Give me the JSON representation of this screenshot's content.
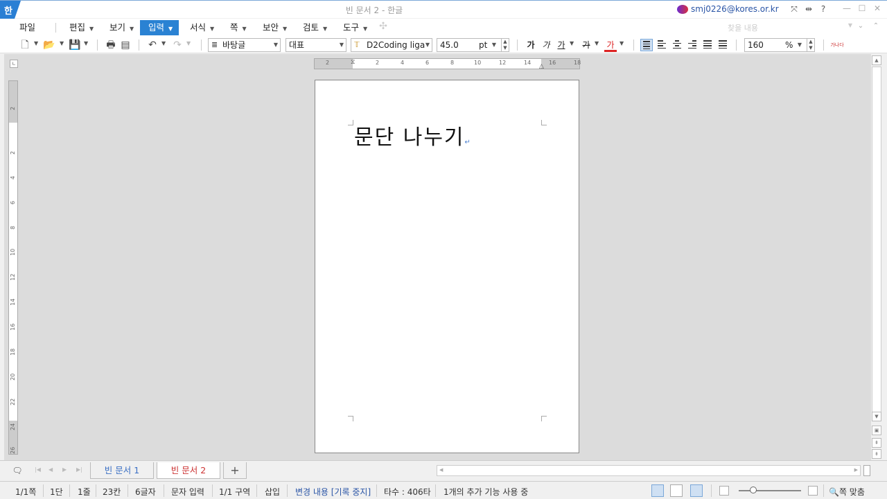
{
  "titlebar": {
    "logo": "한",
    "title": "빈 문서 2 - 한글",
    "account": "smj0226@kores.or.kr",
    "help": "?"
  },
  "menu": {
    "items": [
      {
        "label": "파일"
      },
      {
        "label": "편집"
      },
      {
        "label": "보기"
      },
      {
        "label": "입력"
      },
      {
        "label": "서식"
      },
      {
        "label": "쪽"
      },
      {
        "label": "보안"
      },
      {
        "label": "검토"
      },
      {
        "label": "도구"
      }
    ],
    "active": "입력",
    "search_placeholder": "찾을 내용"
  },
  "toolbar": {
    "style_combo": "바탕글",
    "lang_combo": "대표",
    "font_combo": "D2Coding liga",
    "size_value": "45.0",
    "size_unit": "pt",
    "bold": "가",
    "italic": "가",
    "underline": "가",
    "strike": "가",
    "color": "가",
    "zoom_value": "160",
    "zoom_unit": "%",
    "extra": "가나다"
  },
  "ruler": {
    "h_ticks": [
      "2",
      "2",
      "4",
      "6",
      "8",
      "10",
      "12",
      "14",
      "16",
      "18"
    ],
    "v_ticks": [
      "2",
      "2",
      "4",
      "6",
      "8",
      "10",
      "12",
      "14",
      "16",
      "18",
      "20",
      "22",
      "24",
      "26"
    ]
  },
  "document": {
    "text": "문단 나누기",
    "para_mark": "↵"
  },
  "tabs": [
    {
      "label": "빈 문서 1",
      "active": false
    },
    {
      "label": "빈 문서 2",
      "active": true
    }
  ],
  "add_tab": "+",
  "status": {
    "page": "1/1쪽",
    "column": "1단",
    "line": "1줄",
    "cell": "23칸",
    "chars": "6글자",
    "input_mode": "문자 입력",
    "section": "1/1 구역",
    "insert": "삽입",
    "track_changes": "변경 내용 [기록 중지]",
    "typing_count": "타수 : 406타",
    "addons": "1개의 추가 기능 사용 중",
    "fit": "쪽 맞춤"
  }
}
